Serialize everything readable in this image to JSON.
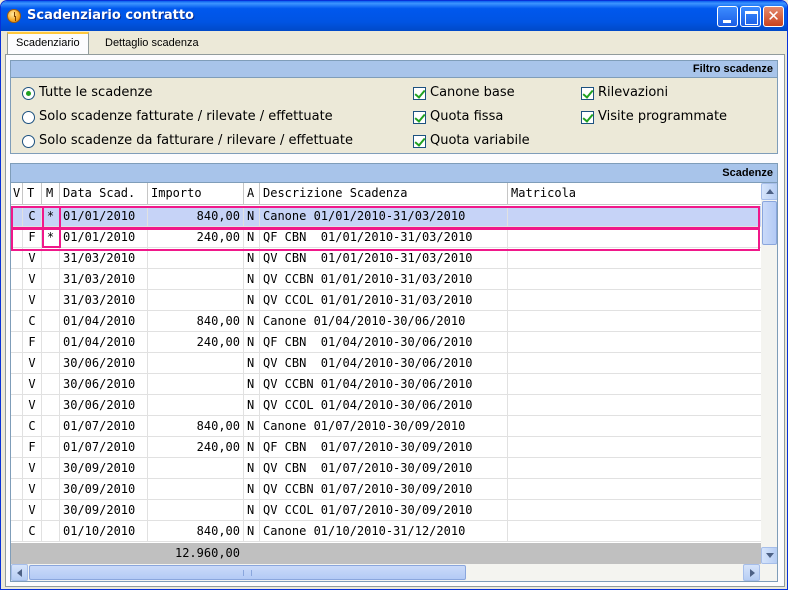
{
  "window": {
    "title": "Scadenziario contratto"
  },
  "tabs": [
    {
      "label": "Scadenziario",
      "active": true
    },
    {
      "label": "Dettaglio scadenza",
      "active": false
    }
  ],
  "filter": {
    "title": "Filtro scadenze",
    "radios": [
      {
        "label": "Tutte le scadenze",
        "checked": true
      },
      {
        "label": "Solo scadenze fatturate / rilevate / effettuate",
        "checked": false
      },
      {
        "label": "Solo scadenze da fatturare / rilevare / effettuate",
        "checked": false
      }
    ],
    "checks_col1": [
      {
        "label": "Canone base",
        "checked": true
      },
      {
        "label": "Quota fissa",
        "checked": true
      },
      {
        "label": "Quota variabile",
        "checked": true
      }
    ],
    "checks_col2": [
      {
        "label": "Rilevazioni",
        "checked": true
      },
      {
        "label": "Visite programmate",
        "checked": true
      }
    ]
  },
  "grid": {
    "title": "Scadenze",
    "columns": [
      "V",
      "T",
      "M",
      "Data Scad.",
      "Importo",
      "A",
      "Descrizione Scadenza",
      "Matricola"
    ],
    "rows": [
      {
        "v": "",
        "t": "C",
        "m": "*",
        "data": "01/01/2010",
        "importo": "840,00",
        "a": "N",
        "desc": "Canone 01/01/2010-31/03/2010",
        "matricola": ""
      },
      {
        "v": "",
        "t": "F",
        "m": "*",
        "data": "01/01/2010",
        "importo": "240,00",
        "a": "N",
        "desc": "QF CBN  01/01/2010-31/03/2010",
        "matricola": ""
      },
      {
        "v": "",
        "t": "V",
        "m": "",
        "data": "31/03/2010",
        "importo": "",
        "a": "N",
        "desc": "QV CBN  01/01/2010-31/03/2010",
        "matricola": ""
      },
      {
        "v": "",
        "t": "V",
        "m": "",
        "data": "31/03/2010",
        "importo": "",
        "a": "N",
        "desc": "QV CCBN 01/01/2010-31/03/2010",
        "matricola": ""
      },
      {
        "v": "",
        "t": "V",
        "m": "",
        "data": "31/03/2010",
        "importo": "",
        "a": "N",
        "desc": "QV CCOL 01/01/2010-31/03/2010",
        "matricola": ""
      },
      {
        "v": "",
        "t": "C",
        "m": "",
        "data": "01/04/2010",
        "importo": "840,00",
        "a": "N",
        "desc": "Canone 01/04/2010-30/06/2010",
        "matricola": ""
      },
      {
        "v": "",
        "t": "F",
        "m": "",
        "data": "01/04/2010",
        "importo": "240,00",
        "a": "N",
        "desc": "QF CBN  01/04/2010-30/06/2010",
        "matricola": ""
      },
      {
        "v": "",
        "t": "V",
        "m": "",
        "data": "30/06/2010",
        "importo": "",
        "a": "N",
        "desc": "QV CBN  01/04/2010-30/06/2010",
        "matricola": ""
      },
      {
        "v": "",
        "t": "V",
        "m": "",
        "data": "30/06/2010",
        "importo": "",
        "a": "N",
        "desc": "QV CCBN 01/04/2010-30/06/2010",
        "matricola": ""
      },
      {
        "v": "",
        "t": "V",
        "m": "",
        "data": "30/06/2010",
        "importo": "",
        "a": "N",
        "desc": "QV CCOL 01/04/2010-30/06/2010",
        "matricola": ""
      },
      {
        "v": "",
        "t": "C",
        "m": "",
        "data": "01/07/2010",
        "importo": "840,00",
        "a": "N",
        "desc": "Canone 01/07/2010-30/09/2010",
        "matricola": ""
      },
      {
        "v": "",
        "t": "F",
        "m": "",
        "data": "01/07/2010",
        "importo": "240,00",
        "a": "N",
        "desc": "QF CBN  01/07/2010-30/09/2010",
        "matricola": ""
      },
      {
        "v": "",
        "t": "V",
        "m": "",
        "data": "30/09/2010",
        "importo": "",
        "a": "N",
        "desc": "QV CBN  01/07/2010-30/09/2010",
        "matricola": ""
      },
      {
        "v": "",
        "t": "V",
        "m": "",
        "data": "30/09/2010",
        "importo": "",
        "a": "N",
        "desc": "QV CCBN 01/07/2010-30/09/2010",
        "matricola": ""
      },
      {
        "v": "",
        "t": "V",
        "m": "",
        "data": "30/09/2010",
        "importo": "",
        "a": "N",
        "desc": "QV CCOL 01/07/2010-30/09/2010",
        "matricola": ""
      },
      {
        "v": "",
        "t": "C",
        "m": "",
        "data": "01/10/2010",
        "importo": "840,00",
        "a": "N",
        "desc": "Canone 01/10/2010-31/12/2010",
        "matricola": ""
      }
    ],
    "total": "12.960,00"
  },
  "colors": {
    "highlight": "#F0188A",
    "selected_row": "#C6D3F7",
    "section_header": "#A8C4EA"
  }
}
